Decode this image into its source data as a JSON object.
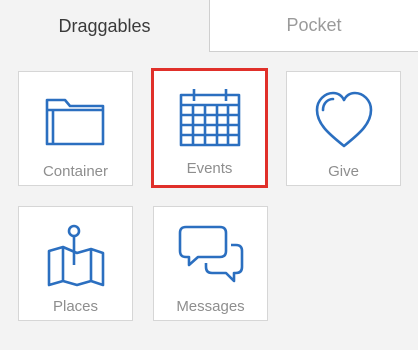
{
  "tabs": [
    {
      "label": "Draggables",
      "active": true
    },
    {
      "label": "Pocket",
      "active": false
    }
  ],
  "tiles": [
    {
      "label": "Container",
      "icon": "folder-icon"
    },
    {
      "label": "Events",
      "icon": "calendar-icon",
      "selected": true
    },
    {
      "label": "Give",
      "icon": "heart-icon"
    },
    {
      "label": "Places",
      "icon": "map-pin-icon"
    },
    {
      "label": "Messages",
      "icon": "chat-bubbles-icon"
    }
  ],
  "colors": {
    "icon_blue": "#2b6fc0",
    "selection_red": "#e0302a",
    "label_gray": "#8e8e8e"
  }
}
